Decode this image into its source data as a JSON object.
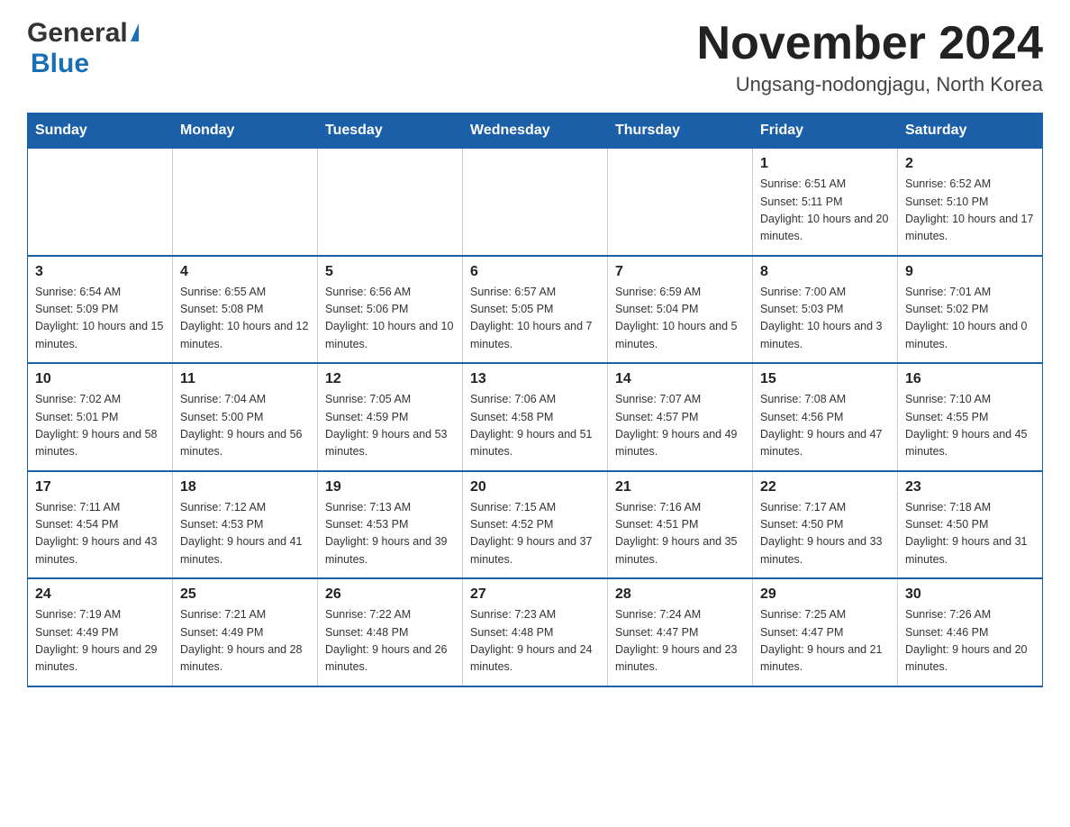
{
  "header": {
    "logo_general": "General",
    "logo_blue": "Blue",
    "title": "November 2024",
    "subtitle": "Ungsang-nodongjagu, North Korea"
  },
  "weekdays": [
    "Sunday",
    "Monday",
    "Tuesday",
    "Wednesday",
    "Thursday",
    "Friday",
    "Saturday"
  ],
  "weeks": [
    [
      {
        "day": "",
        "sunrise": "",
        "sunset": "",
        "daylight": ""
      },
      {
        "day": "",
        "sunrise": "",
        "sunset": "",
        "daylight": ""
      },
      {
        "day": "",
        "sunrise": "",
        "sunset": "",
        "daylight": ""
      },
      {
        "day": "",
        "sunrise": "",
        "sunset": "",
        "daylight": ""
      },
      {
        "day": "",
        "sunrise": "",
        "sunset": "",
        "daylight": ""
      },
      {
        "day": "1",
        "sunrise": "Sunrise: 6:51 AM",
        "sunset": "Sunset: 5:11 PM",
        "daylight": "Daylight: 10 hours and 20 minutes."
      },
      {
        "day": "2",
        "sunrise": "Sunrise: 6:52 AM",
        "sunset": "Sunset: 5:10 PM",
        "daylight": "Daylight: 10 hours and 17 minutes."
      }
    ],
    [
      {
        "day": "3",
        "sunrise": "Sunrise: 6:54 AM",
        "sunset": "Sunset: 5:09 PM",
        "daylight": "Daylight: 10 hours and 15 minutes."
      },
      {
        "day": "4",
        "sunrise": "Sunrise: 6:55 AM",
        "sunset": "Sunset: 5:08 PM",
        "daylight": "Daylight: 10 hours and 12 minutes."
      },
      {
        "day": "5",
        "sunrise": "Sunrise: 6:56 AM",
        "sunset": "Sunset: 5:06 PM",
        "daylight": "Daylight: 10 hours and 10 minutes."
      },
      {
        "day": "6",
        "sunrise": "Sunrise: 6:57 AM",
        "sunset": "Sunset: 5:05 PM",
        "daylight": "Daylight: 10 hours and 7 minutes."
      },
      {
        "day": "7",
        "sunrise": "Sunrise: 6:59 AM",
        "sunset": "Sunset: 5:04 PM",
        "daylight": "Daylight: 10 hours and 5 minutes."
      },
      {
        "day": "8",
        "sunrise": "Sunrise: 7:00 AM",
        "sunset": "Sunset: 5:03 PM",
        "daylight": "Daylight: 10 hours and 3 minutes."
      },
      {
        "day": "9",
        "sunrise": "Sunrise: 7:01 AM",
        "sunset": "Sunset: 5:02 PM",
        "daylight": "Daylight: 10 hours and 0 minutes."
      }
    ],
    [
      {
        "day": "10",
        "sunrise": "Sunrise: 7:02 AM",
        "sunset": "Sunset: 5:01 PM",
        "daylight": "Daylight: 9 hours and 58 minutes."
      },
      {
        "day": "11",
        "sunrise": "Sunrise: 7:04 AM",
        "sunset": "Sunset: 5:00 PM",
        "daylight": "Daylight: 9 hours and 56 minutes."
      },
      {
        "day": "12",
        "sunrise": "Sunrise: 7:05 AM",
        "sunset": "Sunset: 4:59 PM",
        "daylight": "Daylight: 9 hours and 53 minutes."
      },
      {
        "day": "13",
        "sunrise": "Sunrise: 7:06 AM",
        "sunset": "Sunset: 4:58 PM",
        "daylight": "Daylight: 9 hours and 51 minutes."
      },
      {
        "day": "14",
        "sunrise": "Sunrise: 7:07 AM",
        "sunset": "Sunset: 4:57 PM",
        "daylight": "Daylight: 9 hours and 49 minutes."
      },
      {
        "day": "15",
        "sunrise": "Sunrise: 7:08 AM",
        "sunset": "Sunset: 4:56 PM",
        "daylight": "Daylight: 9 hours and 47 minutes."
      },
      {
        "day": "16",
        "sunrise": "Sunrise: 7:10 AM",
        "sunset": "Sunset: 4:55 PM",
        "daylight": "Daylight: 9 hours and 45 minutes."
      }
    ],
    [
      {
        "day": "17",
        "sunrise": "Sunrise: 7:11 AM",
        "sunset": "Sunset: 4:54 PM",
        "daylight": "Daylight: 9 hours and 43 minutes."
      },
      {
        "day": "18",
        "sunrise": "Sunrise: 7:12 AM",
        "sunset": "Sunset: 4:53 PM",
        "daylight": "Daylight: 9 hours and 41 minutes."
      },
      {
        "day": "19",
        "sunrise": "Sunrise: 7:13 AM",
        "sunset": "Sunset: 4:53 PM",
        "daylight": "Daylight: 9 hours and 39 minutes."
      },
      {
        "day": "20",
        "sunrise": "Sunrise: 7:15 AM",
        "sunset": "Sunset: 4:52 PM",
        "daylight": "Daylight: 9 hours and 37 minutes."
      },
      {
        "day": "21",
        "sunrise": "Sunrise: 7:16 AM",
        "sunset": "Sunset: 4:51 PM",
        "daylight": "Daylight: 9 hours and 35 minutes."
      },
      {
        "day": "22",
        "sunrise": "Sunrise: 7:17 AM",
        "sunset": "Sunset: 4:50 PM",
        "daylight": "Daylight: 9 hours and 33 minutes."
      },
      {
        "day": "23",
        "sunrise": "Sunrise: 7:18 AM",
        "sunset": "Sunset: 4:50 PM",
        "daylight": "Daylight: 9 hours and 31 minutes."
      }
    ],
    [
      {
        "day": "24",
        "sunrise": "Sunrise: 7:19 AM",
        "sunset": "Sunset: 4:49 PM",
        "daylight": "Daylight: 9 hours and 29 minutes."
      },
      {
        "day": "25",
        "sunrise": "Sunrise: 7:21 AM",
        "sunset": "Sunset: 4:49 PM",
        "daylight": "Daylight: 9 hours and 28 minutes."
      },
      {
        "day": "26",
        "sunrise": "Sunrise: 7:22 AM",
        "sunset": "Sunset: 4:48 PM",
        "daylight": "Daylight: 9 hours and 26 minutes."
      },
      {
        "day": "27",
        "sunrise": "Sunrise: 7:23 AM",
        "sunset": "Sunset: 4:48 PM",
        "daylight": "Daylight: 9 hours and 24 minutes."
      },
      {
        "day": "28",
        "sunrise": "Sunrise: 7:24 AM",
        "sunset": "Sunset: 4:47 PM",
        "daylight": "Daylight: 9 hours and 23 minutes."
      },
      {
        "day": "29",
        "sunrise": "Sunrise: 7:25 AM",
        "sunset": "Sunset: 4:47 PM",
        "daylight": "Daylight: 9 hours and 21 minutes."
      },
      {
        "day": "30",
        "sunrise": "Sunrise: 7:26 AM",
        "sunset": "Sunset: 4:46 PM",
        "daylight": "Daylight: 9 hours and 20 minutes."
      }
    ]
  ]
}
